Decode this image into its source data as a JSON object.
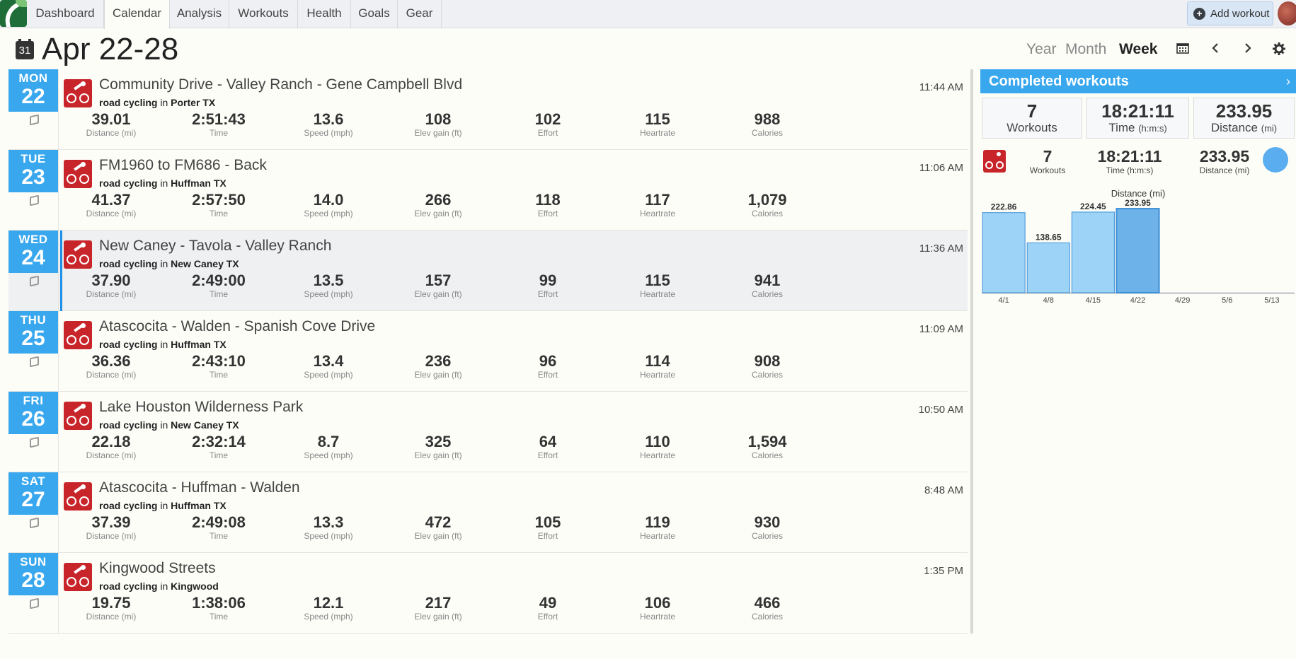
{
  "nav": {
    "tabs": [
      {
        "label": "Dashboard"
      },
      {
        "label": "Calendar"
      },
      {
        "label": "Analysis"
      },
      {
        "label": "Workouts"
      },
      {
        "label": "Health"
      },
      {
        "label": "Goals"
      },
      {
        "label": "Gear"
      }
    ],
    "active_tab": "Calendar",
    "add_workout": "Add workout"
  },
  "header": {
    "calendar_icon_day": "31",
    "title": "Apr 22-28",
    "views": [
      "Year",
      "Month",
      "Week"
    ],
    "active_view": "Week"
  },
  "workouts": [
    {
      "day": "MON",
      "date": "22",
      "title": "Community Drive - Valley Ranch - Gene Campbell Blvd",
      "sport": "road cycling",
      "in": "in",
      "location": "Porter TX",
      "time": "11:44 AM",
      "stats": [
        {
          "v": "39.01",
          "l": "Distance (mi)"
        },
        {
          "v": "2:51:43",
          "l": "Time"
        },
        {
          "v": "13.6",
          "l": "Speed (mph)"
        },
        {
          "v": "108",
          "l": "Elev gain (ft)"
        },
        {
          "v": "102",
          "l": "Effort"
        },
        {
          "v": "115",
          "l": "Heartrate"
        },
        {
          "v": "988",
          "l": "Calories"
        }
      ]
    },
    {
      "day": "TUE",
      "date": "23",
      "title": "FM1960 to FM686 - Back",
      "sport": "road cycling",
      "in": "in",
      "location": "Huffman TX",
      "time": "11:06 AM",
      "stats": [
        {
          "v": "41.37",
          "l": "Distance (mi)"
        },
        {
          "v": "2:57:50",
          "l": "Time"
        },
        {
          "v": "14.0",
          "l": "Speed (mph)"
        },
        {
          "v": "266",
          "l": "Elev gain (ft)"
        },
        {
          "v": "118",
          "l": "Effort"
        },
        {
          "v": "117",
          "l": "Heartrate"
        },
        {
          "v": "1,079",
          "l": "Calories"
        }
      ]
    },
    {
      "day": "WED",
      "date": "24",
      "title": "New Caney - Tavola - Valley Ranch",
      "sport": "road cycling",
      "in": "in",
      "location": "New Caney TX",
      "time": "11:36 AM",
      "stats": [
        {
          "v": "37.90",
          "l": "Distance (mi)"
        },
        {
          "v": "2:49:00",
          "l": "Time"
        },
        {
          "v": "13.5",
          "l": "Speed (mph)"
        },
        {
          "v": "157",
          "l": "Elev gain (ft)"
        },
        {
          "v": "99",
          "l": "Effort"
        },
        {
          "v": "115",
          "l": "Heartrate"
        },
        {
          "v": "941",
          "l": "Calories"
        }
      ]
    },
    {
      "day": "THU",
      "date": "25",
      "title": "Atascocita - Walden - Spanish Cove Drive",
      "sport": "road cycling",
      "in": "in",
      "location": "Huffman TX",
      "time": "11:09 AM",
      "stats": [
        {
          "v": "36.36",
          "l": "Distance (mi)"
        },
        {
          "v": "2:43:10",
          "l": "Time"
        },
        {
          "v": "13.4",
          "l": "Speed (mph)"
        },
        {
          "v": "236",
          "l": "Elev gain (ft)"
        },
        {
          "v": "96",
          "l": "Effort"
        },
        {
          "v": "114",
          "l": "Heartrate"
        },
        {
          "v": "908",
          "l": "Calories"
        }
      ]
    },
    {
      "day": "FRI",
      "date": "26",
      "title": "Lake Houston Wilderness Park",
      "sport": "road cycling",
      "in": "in",
      "location": "New Caney TX",
      "time": "10:50 AM",
      "stats": [
        {
          "v": "22.18",
          "l": "Distance (mi)"
        },
        {
          "v": "2:32:14",
          "l": "Time"
        },
        {
          "v": "8.7",
          "l": "Speed (mph)"
        },
        {
          "v": "325",
          "l": "Elev gain (ft)"
        },
        {
          "v": "64",
          "l": "Effort"
        },
        {
          "v": "110",
          "l": "Heartrate"
        },
        {
          "v": "1,594",
          "l": "Calories"
        }
      ]
    },
    {
      "day": "SAT",
      "date": "27",
      "title": "Atascocita - Huffman - Walden",
      "sport": "road cycling",
      "in": "in",
      "location": "Huffman TX",
      "time": "8:48 AM",
      "stats": [
        {
          "v": "37.39",
          "l": "Distance (mi)"
        },
        {
          "v": "2:49:08",
          "l": "Time"
        },
        {
          "v": "13.3",
          "l": "Speed (mph)"
        },
        {
          "v": "472",
          "l": "Elev gain (ft)"
        },
        {
          "v": "105",
          "l": "Effort"
        },
        {
          "v": "119",
          "l": "Heartrate"
        },
        {
          "v": "930",
          "l": "Calories"
        }
      ]
    },
    {
      "day": "SUN",
      "date": "28",
      "title": "Kingwood Streets",
      "sport": "road cycling",
      "in": "in",
      "location": "Kingwood",
      "time": "1:35 PM",
      "stats": [
        {
          "v": "19.75",
          "l": "Distance (mi)"
        },
        {
          "v": "1:38:06",
          "l": "Time"
        },
        {
          "v": "12.1",
          "l": "Speed (mph)"
        },
        {
          "v": "217",
          "l": "Elev gain (ft)"
        },
        {
          "v": "49",
          "l": "Effort"
        },
        {
          "v": "106",
          "l": "Heartrate"
        },
        {
          "v": "466",
          "l": "Calories"
        }
      ]
    }
  ],
  "selected_day": "WED",
  "panel": {
    "title": "Completed workouts",
    "summary": [
      {
        "v": "7",
        "l": "Workouts",
        "unit": ""
      },
      {
        "v": "18:21:11",
        "l": "Time",
        "unit": "(h:m:s)"
      },
      {
        "v": "233.95",
        "l": "Distance",
        "unit": "(mi)"
      }
    ],
    "sport_row": [
      {
        "v": "7",
        "l": "Workouts"
      },
      {
        "v": "18:21:11",
        "l": "Time (h:m:s)"
      },
      {
        "v": "233.95",
        "l": "Distance (mi)"
      }
    ]
  },
  "colors": {
    "accent": "#38a7ee",
    "sport": "#c8252b",
    "bar": "#9dd3f7",
    "bar_current": "#6db3ea"
  },
  "chart_data": {
    "type": "bar",
    "title": "Distance (mi)",
    "categories": [
      "4/1",
      "4/8",
      "4/15",
      "4/22",
      "4/29",
      "5/6",
      "5/13"
    ],
    "values": [
      222.86,
      138.65,
      224.45,
      233.95,
      null,
      null,
      null
    ],
    "labels": [
      "222.86",
      "138.65",
      "224.45",
      "233.95",
      "",
      "",
      ""
    ],
    "highlight_index": 3,
    "ylim": [
      0,
      240
    ]
  }
}
